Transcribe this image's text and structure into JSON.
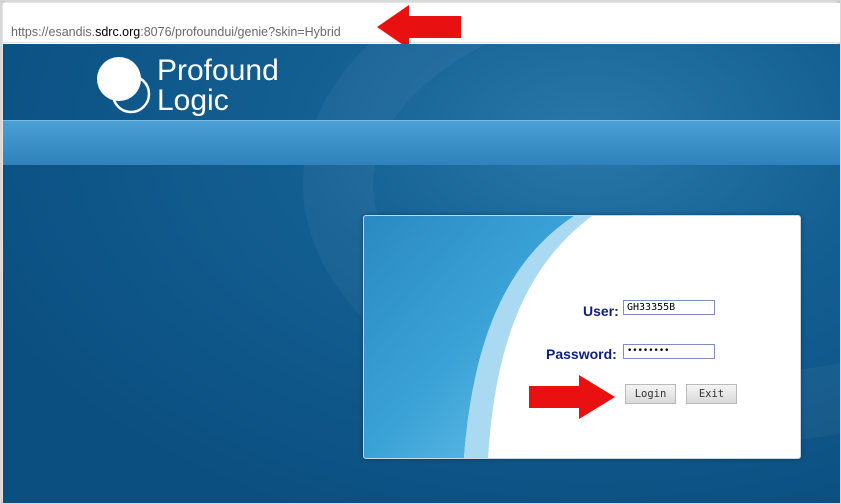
{
  "browser": {
    "url_prefix": "https://esandis.",
    "url_domain": "sdrc.org",
    "url_suffix": ":8076/profoundui/genie?skin=Hybrid"
  },
  "brand": {
    "name_line1": "Profound",
    "name_line2": "Logic"
  },
  "login": {
    "user_label": "User:",
    "user_value": "GH33355B",
    "password_label": "Password:",
    "password_mask": "••••••••",
    "login_button": "Login",
    "exit_button": "Exit"
  },
  "colors": {
    "annotation_arrow": "#e81010",
    "label_text": "#0f1e7a",
    "header_band": "#3d92c9"
  },
  "icons": [
    "arrow-left-icon",
    "arrow-right-icon",
    "profound-logic-logo"
  ]
}
